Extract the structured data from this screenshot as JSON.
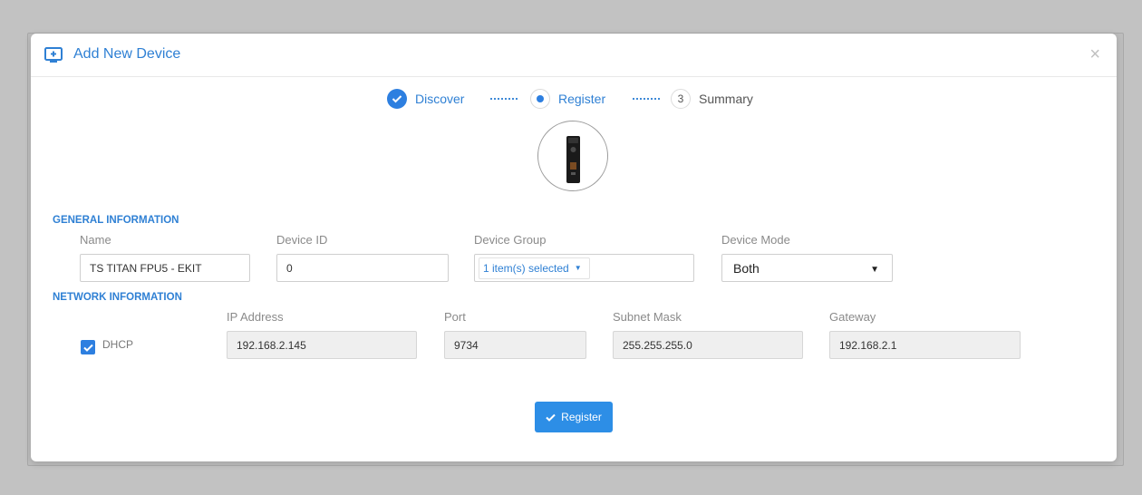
{
  "modal": {
    "title": "Add New Device",
    "close": "×",
    "icon": "monitor-plus-icon"
  },
  "stepper": {
    "steps": [
      {
        "label": "Discover",
        "state": "done"
      },
      {
        "label": "Register",
        "state": "active"
      },
      {
        "number": "3",
        "label": "Summary",
        "state": "todo"
      }
    ]
  },
  "general": {
    "title": "GENERAL INFORMATION",
    "name_label": "Name",
    "name_value": "TS TITAN FPU5 - EKIT",
    "device_id_label": "Device ID",
    "device_id_value": "0",
    "device_group_label": "Device Group",
    "device_group_value": "1 item(s) selected",
    "device_mode_label": "Device Mode",
    "device_mode_value": "Both"
  },
  "network": {
    "title": "NETWORK INFORMATION",
    "dhcp_label": "DHCP",
    "dhcp_checked": true,
    "ip_label": "IP Address",
    "ip_value": "192.168.2.145",
    "port_label": "Port",
    "port_value": "9734",
    "subnet_label": "Subnet Mask",
    "subnet_value": "255.255.255.0",
    "gateway_label": "Gateway",
    "gateway_value": "192.168.2.1"
  },
  "actions": {
    "register_label": "Register"
  },
  "colors": {
    "accent": "#2d7fe0",
    "button": "#2d8ee6",
    "backdrop": "#c2c2c2"
  }
}
